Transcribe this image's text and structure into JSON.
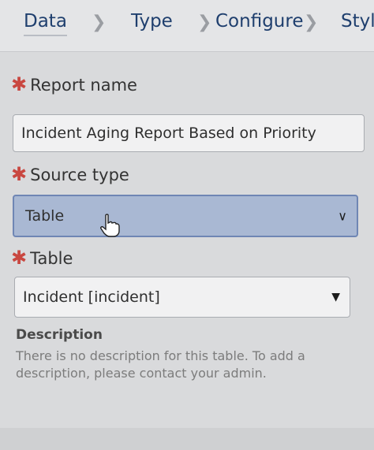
{
  "tabs": {
    "data": "Data",
    "type": "Type",
    "configure": "Configure",
    "style": "Styl"
  },
  "form": {
    "report_name_label": "Report name",
    "report_name_value": "Incident Aging Report Based on Priority",
    "source_type_label": "Source type",
    "source_type_value": "Table",
    "table_label": "Table",
    "table_value": "Incident [incident]",
    "required_mark": "✱"
  },
  "description": {
    "title": "Description",
    "text": "There is no description for this table. To add a description, please contact your admin."
  },
  "colors": {
    "required": "#c94740",
    "tab_text": "#1f3f6e",
    "select_highlight": "#a9b8d3"
  },
  "icons": {
    "chevron": "chevron-right-icon",
    "caret": "caret-down-icon",
    "cursor": "hand-pointer-icon"
  }
}
